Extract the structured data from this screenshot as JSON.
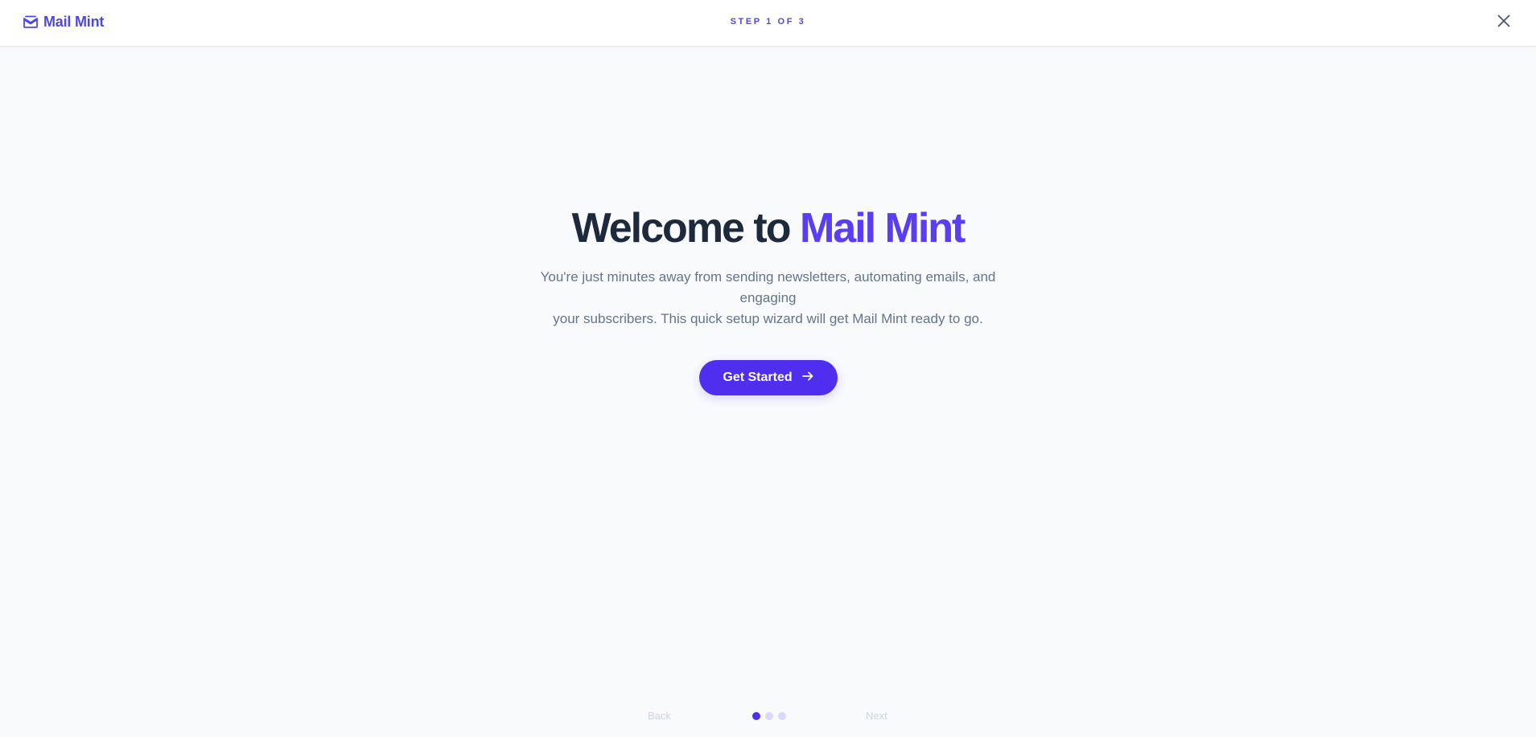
{
  "header": {
    "brand": "Mail Mint",
    "step_label": "STEP 1 OF 3"
  },
  "hero": {
    "title_prefix": "Welcome to",
    "title_accent": "Mail Mint",
    "subtitle_line1": "You're just minutes away from sending newsletters, automating emails, and engaging",
    "subtitle_line2": "your subscribers. This quick setup wizard will get Mail Mint ready to go.",
    "cta_label": "Get Started"
  },
  "footer": {
    "back_label": "Back",
    "next_label": "Next",
    "current_step": 1,
    "total_steps": 3
  },
  "colors": {
    "accent": "#4f2ef0",
    "brand": "#4f46e5",
    "heading": "#1e293b",
    "muted": "#64748b",
    "disabled": "#cbd5e1"
  },
  "icons": {
    "brand": "mail-icon",
    "close": "close-icon",
    "cta": "arrow-right-icon"
  }
}
